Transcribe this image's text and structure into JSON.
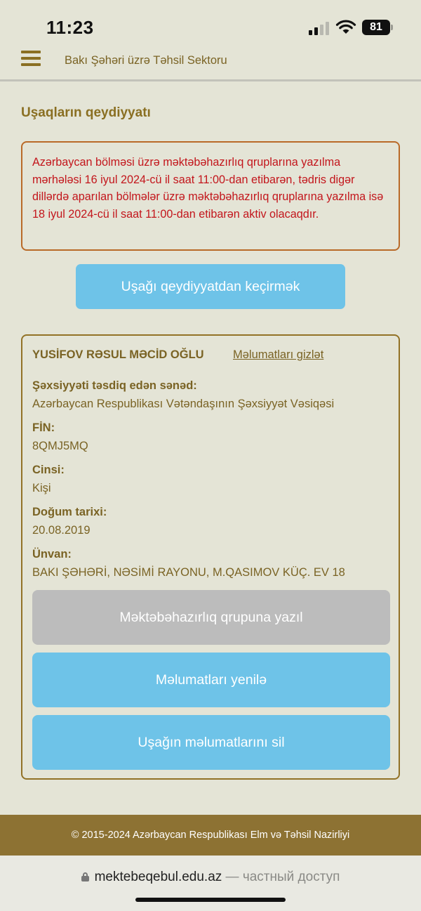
{
  "status_bar": {
    "time": "11:23",
    "battery": "81"
  },
  "header": {
    "title": "Bakı Şəhəri üzrə Təhsil Sektoru",
    "menu_icon": "hamburger-icon"
  },
  "page": {
    "title": "Uşaqların qeydiyyatı"
  },
  "alert": {
    "text": "Azərbaycan bölməsi üzrə məktəbəhazırlıq qruplarına yazılma mərhələsi 16 iyul 2024-cü il saat 11:00-dan etibarən, tədris digər dillərdə aparılan bölmələr üzrə məktəbəhazırlıq qruplarına yazılma isə 18 iyul 2024-cü il saat 11:00-dan etibarən aktiv olacaqdır.",
    "color": "#c3161c"
  },
  "transfer_button": "Uşağı qeydiyyatdan keçirmək",
  "child": {
    "name": "YUSİFOV RƏSUL MƏCİD OĞLU",
    "hide_link": "Məlumatları gizlət",
    "fields": [
      {
        "label": "Şəxsiyyəti təsdiq edən sənəd:",
        "value": "Azərbaycan Respublikası Vətəndaşının Şəxsiyyət Vəsiqəsi"
      },
      {
        "label": "FİN:",
        "value": "8QMJ5MQ"
      },
      {
        "label": "Cinsi:",
        "value": "Kişi"
      },
      {
        "label": "Doğum tarixi:",
        "value": "20.08.2019"
      },
      {
        "label": "Ünvan:",
        "value": "BAKI ŞƏHƏRİ, NƏSİMİ RAYONU, M.QASIMOV KÜÇ. EV 18"
      }
    ],
    "buttons": {
      "enroll": "Məktəbəhazırlıq qrupuna yazıl",
      "update": "Məlumatları yenilə",
      "delete": "Uşağın məlumatlarını sil"
    }
  },
  "footer": {
    "text": "© 2015-2024 Azərbaycan Respublikası Elm və Təhsil Nazirliyi"
  },
  "browser": {
    "url": "mektebeqebul.edu.az",
    "access": "— частный доступ"
  },
  "colors": {
    "background": "#e4e4d6",
    "accent": "#8a6f22",
    "button_blue": "#6ec3e8",
    "button_disabled": "#bcbcbc",
    "footer": "#8d7233"
  }
}
